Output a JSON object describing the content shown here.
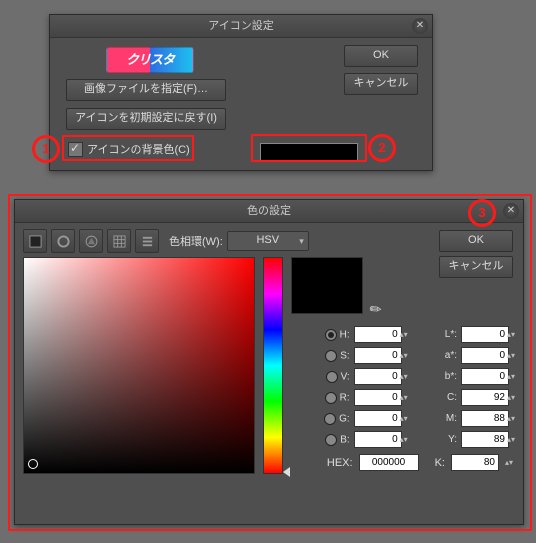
{
  "icon_dialog": {
    "title": "アイコン設定",
    "logo_text": "クリスタ",
    "ok": "OK",
    "cancel": "キャンセル",
    "specify_file": "画像ファイルを指定(F)…",
    "reset": "アイコンを初期設定に戻す(I)",
    "bg_checkbox": "アイコンの背景色(C)"
  },
  "annotations": {
    "a1": "1",
    "a2": "2",
    "a3": "3"
  },
  "color_dialog": {
    "title": "色の設定",
    "ok": "OK",
    "cancel": "キャンセル",
    "ring_label": "色相環(W):",
    "mode": "HSV",
    "labels": {
      "H": "H:",
      "S": "S:",
      "V": "V:",
      "R": "R:",
      "G": "G:",
      "B": "B:",
      "L": "L*:",
      "a": "a*:",
      "b": "b*:",
      "C": "C:",
      "M": "M:",
      "Y": "Y:",
      "K": "K:",
      "HEX": "HEX:"
    },
    "values": {
      "H": "0",
      "S": "0",
      "V": "0",
      "R": "0",
      "G": "0",
      "B": "0",
      "L": "0",
      "a": "0",
      "b": "0",
      "C": "92",
      "M": "88",
      "Y": "89",
      "K": "80",
      "HEX": "000000"
    }
  }
}
